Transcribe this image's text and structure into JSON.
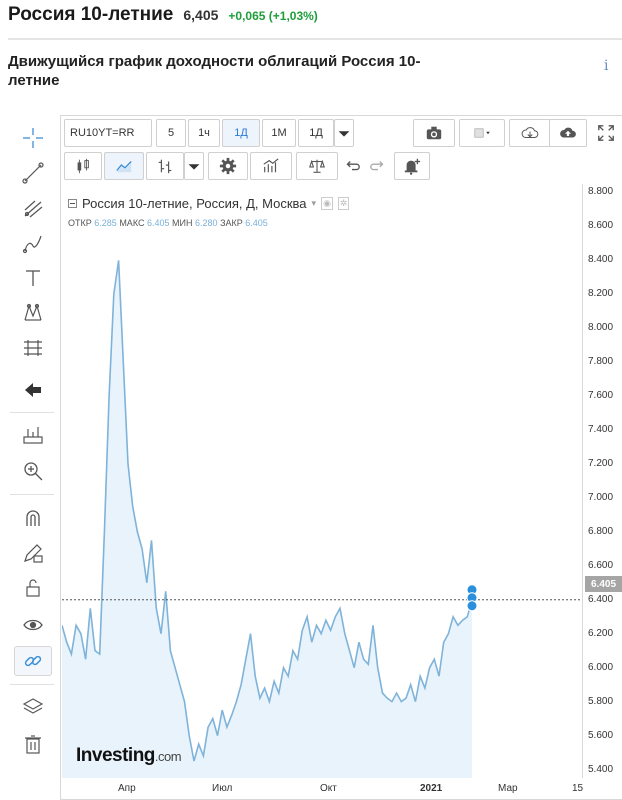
{
  "header": {
    "title": "Россия 10-летние",
    "price": "6,405",
    "change": "+0,065 (+1,03%)"
  },
  "subtitle": "Движущийся график доходности облигаций Россия 10-летние",
  "info_icon": "i",
  "toolbar": {
    "symbol": "RU10YT=RR",
    "intervals": [
      "5",
      "1ч",
      "1Д",
      "1М",
      "1Д"
    ],
    "active_interval": "1Д"
  },
  "legend": {
    "title": "Россия 10-летние, Россия, Д, Москва",
    "open_label": "ОТКР",
    "open": "6.285",
    "high_label": "МАКС",
    "high": "6.405",
    "low_label": "МИН",
    "low": "6.280",
    "close_label": "ЗАКР",
    "close": "6.405"
  },
  "last_price_badge": "6.405",
  "logo": {
    "main": "Investing",
    "suffix": ".com"
  },
  "icons": [
    "crosshair-icon",
    "trend-line-icon",
    "pitchfork-icon",
    "brush-icon",
    "text-icon",
    "pattern-icon",
    "fib-icon",
    "back-arrow-icon",
    "measure-icon",
    "zoom-in-icon",
    "magnet-icon",
    "lock-pencil-icon",
    "unlock-icon",
    "eye-icon",
    "link-icon",
    "layers-icon",
    "trash-icon"
  ],
  "colors": {
    "line": "#7fb3d9",
    "area": "#e8f3fb",
    "accent": "#2a7bd8",
    "positive": "#1e9e3a"
  },
  "chart_data": {
    "type": "area",
    "title": "Россия 10-летние, Россия, Д, Москва",
    "xlabel": "",
    "ylabel": "",
    "ylim": [
      5.35,
      8.85
    ],
    "y_ticks": [
      "8.800",
      "8.600",
      "8.400",
      "8.200",
      "8.000",
      "7.800",
      "7.600",
      "7.400",
      "7.200",
      "7.000",
      "6.800",
      "6.600",
      "6.400",
      "6.200",
      "6.000",
      "5.800",
      "5.600",
      "5.400"
    ],
    "x_ticks": [
      "Апр",
      "Июл",
      "Окт",
      "2021",
      "Мар",
      "15"
    ],
    "series": [
      {
        "values": [
          6.25,
          6.15,
          6.08,
          6.25,
          6.2,
          6.05,
          6.35,
          6.1,
          6.08,
          6.8,
          7.6,
          8.2,
          8.4,
          7.8,
          7.2,
          6.95,
          6.8,
          6.7,
          6.5,
          6.75,
          6.35,
          6.2,
          6.45,
          6.1,
          6.0,
          5.9,
          5.8,
          5.6,
          5.45,
          5.55,
          5.48,
          5.65,
          5.7,
          5.6,
          5.75,
          5.65,
          5.72,
          5.8,
          5.9,
          6.05,
          6.2,
          5.95,
          5.82,
          5.88,
          5.8,
          5.92,
          5.85,
          6.0,
          5.95,
          6.1,
          6.05,
          6.22,
          6.3,
          6.15,
          6.25,
          6.2,
          6.28,
          6.22,
          6.3,
          6.35,
          6.2,
          6.1,
          6.0,
          6.15,
          6.05,
          6.02,
          6.25,
          6.0,
          5.85,
          5.82,
          5.8,
          5.85,
          5.8,
          5.82,
          5.9,
          5.8,
          5.95,
          5.88,
          6.0,
          6.05,
          5.95,
          6.15,
          6.2,
          6.3,
          6.25,
          6.28,
          6.3,
          6.4
        ]
      }
    ]
  }
}
